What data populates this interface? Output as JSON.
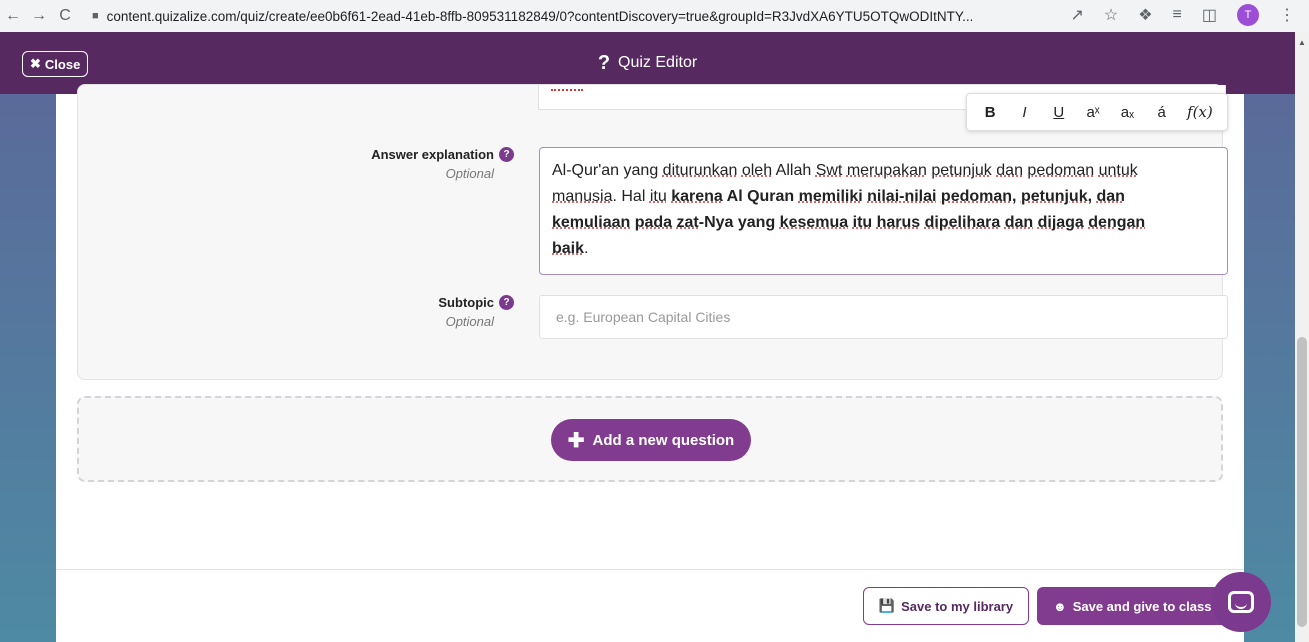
{
  "browser": {
    "back": "←",
    "forward": "→",
    "reload": "C",
    "url": "content.quizalize.com/quiz/create/ee0b6f61-2ead-41eb-8ffb-809531182849/0?contentDiscovery=true&groupId=R3JvdXA6YTU5OTQwODItNTY...",
    "avatar_letter": "T"
  },
  "header": {
    "close_label": "Close",
    "title": "Quiz Editor"
  },
  "answer_explanation": {
    "label": "Answer explanation",
    "optional": "Optional",
    "text_1": "Al-Qur'an yang ",
    "text_2": "diturunkan",
    "text_3": " ",
    "text_4": "oleh",
    "text_5": " Allah ",
    "text_6": "Swt",
    "text_7": " ",
    "text_8": "merupakan",
    "text_9": " ",
    "text_10": "petunjuk",
    "text_11": " ",
    "text_12": "dan",
    "text_13": " ",
    "text_14": "pedoman",
    "text_15": " ",
    "text_16": "untuk",
    "text_17": " ",
    "text_18": "manusia",
    "text_19": ". Hal ",
    "text_20": "itu",
    "bold_1": "karena",
    "bold_2": " Al Quran ",
    "bold_3": "memiliki",
    "bold_4": " ",
    "bold_5": "nilai-nilai",
    "bold_6": " ",
    "bold_7": "pedoman",
    "bold_8": ", ",
    "bold_9": "petunjuk",
    "bold_10": ", ",
    "bold_11": "dan",
    "bold_12": "kemuliaan",
    "bold_13": " ",
    "bold_14": "pada",
    "bold_15": " ",
    "bold_16": "zat",
    "bold_17": "-Nya yang ",
    "bold_18": "kesemua",
    "bold_19": " ",
    "bold_20": "itu",
    "bold_21": " ",
    "bold_22": "harus",
    "bold_23": " ",
    "bold_24": "dipelihara",
    "bold_25": " ",
    "bold_26": "dan",
    "bold_27": " ",
    "bold_28": "dijaga",
    "bold_29": " ",
    "bold_30": "dengan",
    "bold_31": "baik",
    "end": "."
  },
  "toolbar": {
    "bold": "B",
    "italic": "I",
    "underline": "U",
    "superscript": "aˣ",
    "subscript": "aₓ",
    "accent": "á",
    "formula": "f(x)"
  },
  "subtopic": {
    "label": "Subtopic",
    "optional": "Optional",
    "placeholder": "e.g. European Capital Cities"
  },
  "add_question": {
    "label": "Add a new question"
  },
  "footer": {
    "save_library": "Save to my library",
    "save_class": "Save and give to class"
  }
}
